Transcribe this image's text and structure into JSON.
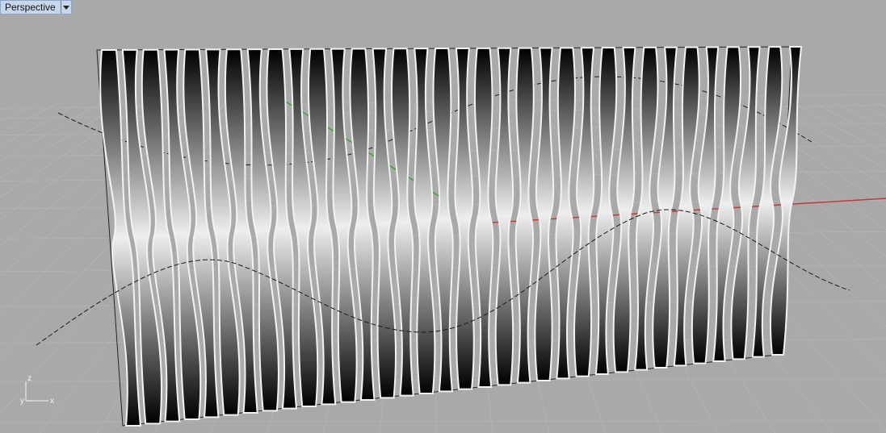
{
  "viewport": {
    "title": "Perspective",
    "menu_icon": "chevron-down-icon"
  },
  "axis_widget": {
    "z_label": "z",
    "x_label": "x",
    "y_label": "y"
  },
  "colors": {
    "background": "#a9a9a9",
    "grid_line": "#b7b7b7",
    "x_axis": "#c43a3a",
    "y_axis": "#3aa33a",
    "curve": "#1a1a1a",
    "strip_dark": "#000000",
    "strip_light": "#f2f2f2"
  }
}
